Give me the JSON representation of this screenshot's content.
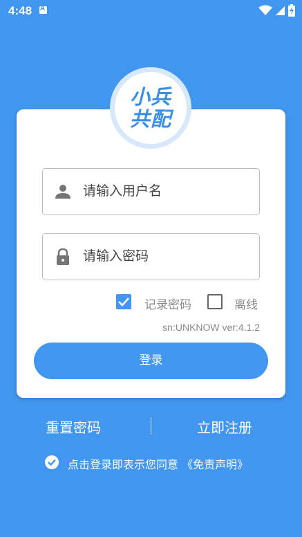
{
  "status_bar": {
    "time": "4:48",
    "icons": [
      "android-auto-icon",
      "wifi-icon",
      "cellular-signal-icon",
      "battery-charging-icon"
    ]
  },
  "logo": {
    "line1": "小兵",
    "line2": "共配",
    "color": "#3a8fe8"
  },
  "form": {
    "username_placeholder": "请输入用户名",
    "username_value": "",
    "password_placeholder": "请输入密码",
    "password_value": "",
    "remember_label": "记录密码",
    "remember_checked": true,
    "offline_label": "离线",
    "offline_checked": false,
    "version": "sn:UNKNOW ver:4.1.2",
    "login_label": "登录"
  },
  "links": {
    "reset_password": "重置密码",
    "register": "立即注册"
  },
  "agreement": {
    "text": "点击登录即表示您同意 《免责声明》",
    "checked": true
  },
  "colors": {
    "background": "#4196ef",
    "accent": "#4196ef",
    "card": "#ffffff"
  }
}
